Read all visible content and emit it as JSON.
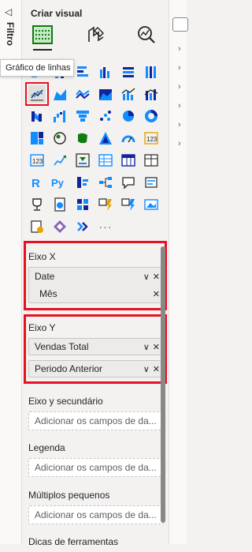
{
  "filters_pane": {
    "label": "Filtro",
    "icon": "filter-icon"
  },
  "viz_pane": {
    "title": "Criar visual",
    "build_buttons": [
      {
        "name": "build-visual-icon"
      },
      {
        "name": "format-visual-icon"
      },
      {
        "name": "analytics-icon"
      }
    ],
    "tooltip": "Gráfico de linhas",
    "more": "···"
  },
  "wells": {
    "x_axis": {
      "title": "Eixo X",
      "field": "Date",
      "subfield": "Mês"
    },
    "y_axis": {
      "title": "Eixo Y",
      "fields": [
        "Vendas Total",
        "Periodo Anterior"
      ]
    },
    "secondary_y": {
      "title": "Eixo y secundário",
      "placeholder": "Adicionar os campos de da..."
    },
    "legend": {
      "title": "Legenda",
      "placeholder": "Adicionar os campos de da..."
    },
    "small_multiples": {
      "title": "Múltiplos pequenos",
      "placeholder": "Adicionar os campos de da..."
    },
    "tooltips": {
      "title": "Dicas de ferramentas"
    }
  },
  "colors": {
    "highlight": "#e81123",
    "accent_green": "#107c10"
  }
}
